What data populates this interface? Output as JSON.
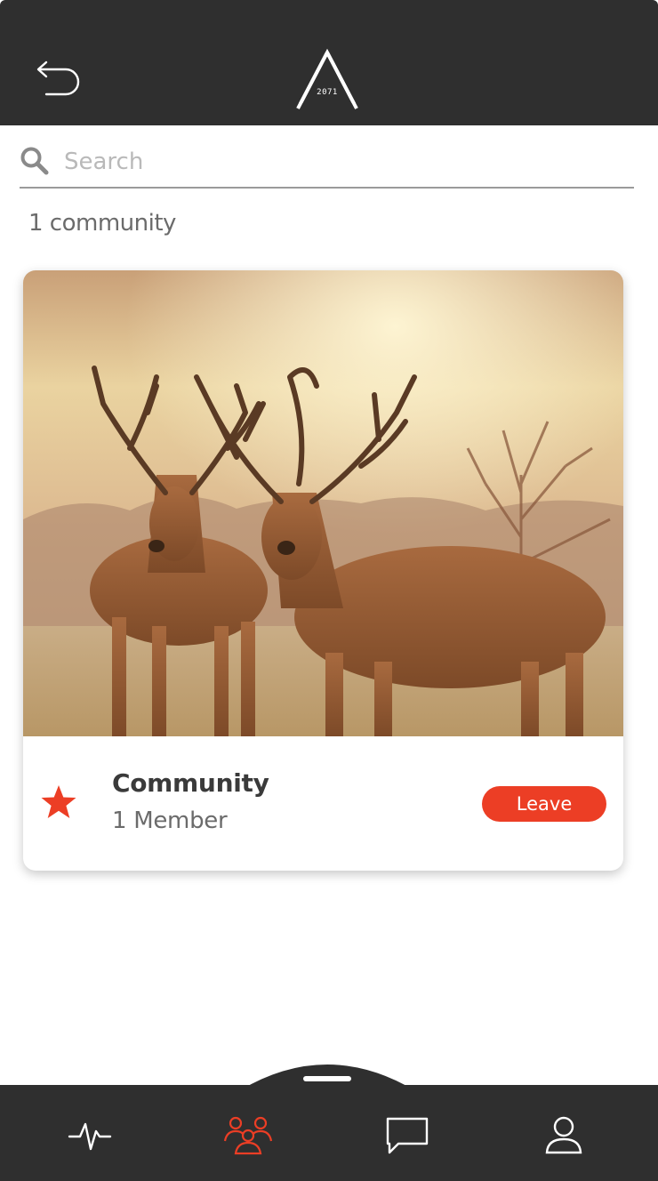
{
  "header": {
    "back_icon": "back-arrow-icon",
    "logo_year": "2071"
  },
  "search": {
    "placeholder": "Search",
    "value": "",
    "icon": "search-icon"
  },
  "results": {
    "count_label": "1 community"
  },
  "community_card": {
    "image": "deer-photo",
    "title": "Community",
    "members": "1 Member",
    "favorite_icon": "star-icon",
    "leave_label": "Leave"
  },
  "bottom_nav": {
    "items": [
      {
        "name": "activity",
        "icon": "pulse-icon",
        "active": false
      },
      {
        "name": "communities",
        "icon": "group-icon",
        "active": true
      },
      {
        "name": "messages",
        "icon": "chat-icon",
        "active": false
      },
      {
        "name": "profile",
        "icon": "user-icon",
        "active": false
      }
    ]
  },
  "colors": {
    "bar_background": "#2f2f2f",
    "accent": "#ec3e25",
    "inactive_icon": "#ffffff"
  }
}
